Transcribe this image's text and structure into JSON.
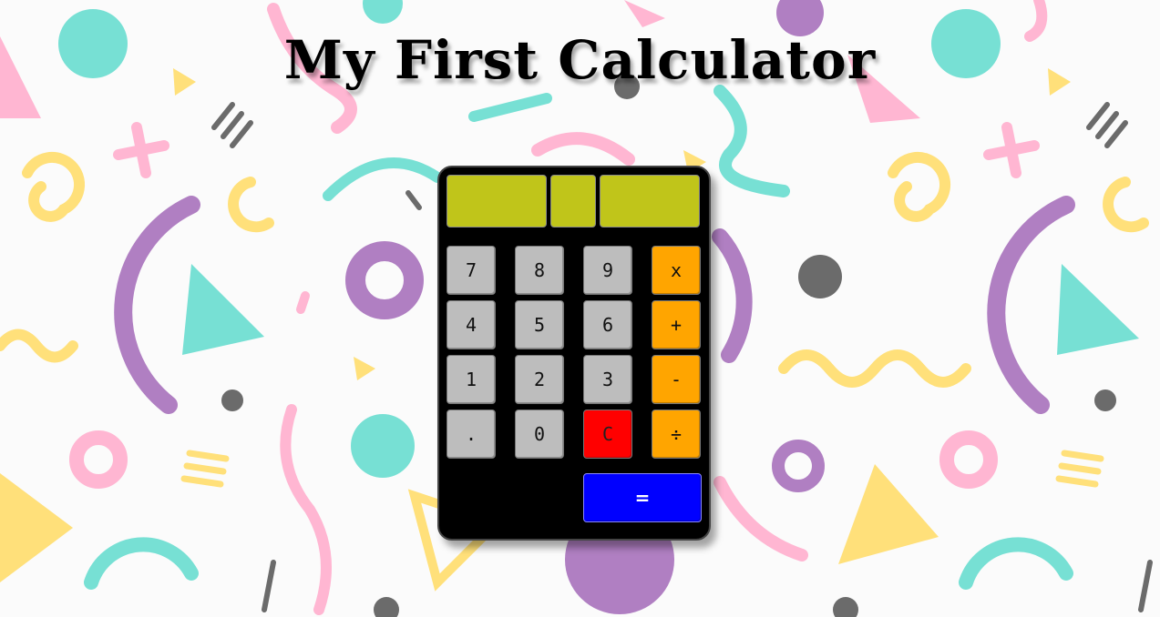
{
  "title": "My First Calculator",
  "display": {
    "left_value": "",
    "operator": "",
    "right_value": ""
  },
  "keys": {
    "k7": "7",
    "k8": "8",
    "k9": "9",
    "multiply": "x",
    "k4": "4",
    "k5": "5",
    "k6": "6",
    "plus": "+",
    "k1": "1",
    "k2": "2",
    "k3": "3",
    "minus": "-",
    "dot": ".",
    "k0": "0",
    "clear": "C",
    "divide": "÷",
    "equals": "="
  },
  "colors": {
    "display": "#c0c51a",
    "number_key": "#bdbdbd",
    "operator_key": "#ffa500",
    "clear_key": "#ff0000",
    "equals_key": "#0000ff",
    "calculator_body": "#000000"
  }
}
